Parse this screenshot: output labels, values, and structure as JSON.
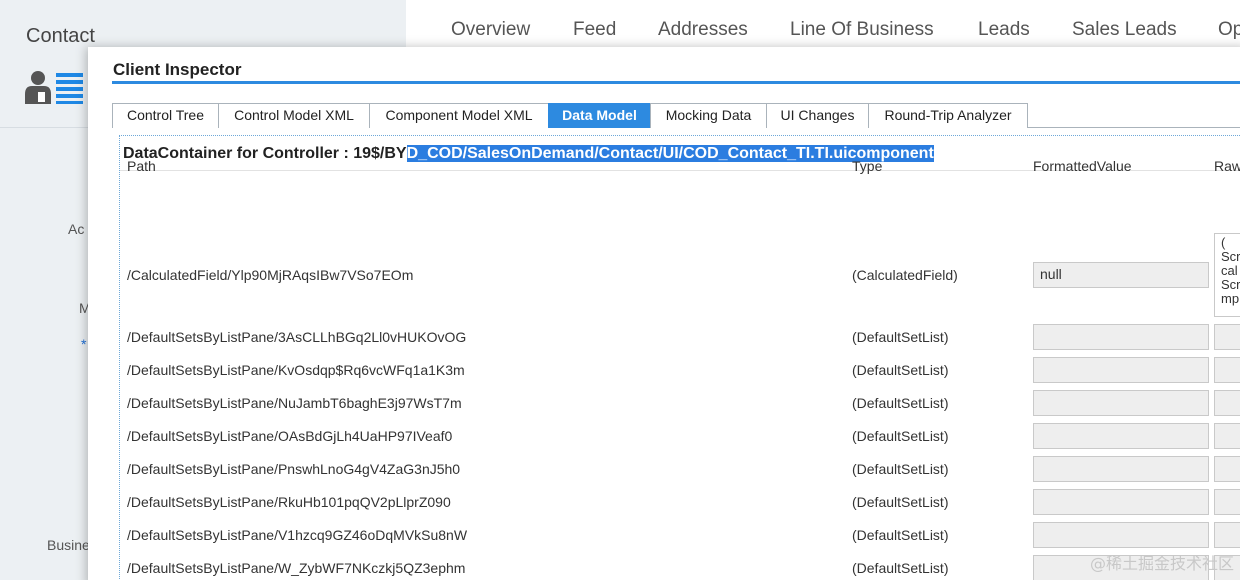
{
  "background": {
    "title": "Contact",
    "left_labels": [
      "Ac",
      "M",
      "*",
      "Busine"
    ],
    "nav_items": [
      "Overview",
      "Feed",
      "Addresses",
      "Line Of Business",
      "Leads",
      "Sales Leads",
      "Op"
    ]
  },
  "inspector": {
    "title": "Client Inspector",
    "tabs": [
      "Control Tree",
      "Control Model XML",
      "Component Model XML",
      "Data Model",
      "Mocking Data",
      "UI Changes",
      "Round-Trip Analyzer"
    ],
    "active_tab": "Data Model",
    "heading_prefix": "DataContainer for Controller : 19$/BY",
    "heading_highlight": "D_COD/SalesOnDemand/Contact/UI/COD_Contact_TI.TI.uicomponent",
    "columns": {
      "path": "Path",
      "type": "Type",
      "formatted": "FormattedValue",
      "raw": "Raw"
    },
    "rows": [
      {
        "path": "/CalculatedField/Ylp90MjRAqsIBw7VSo7EOm",
        "type": "(CalculatedField)",
        "formatted": "null",
        "raw": "(\nScr\ncal\nScr\nmp"
      },
      {
        "path": "/DefaultSetsByListPane/3AsCLLhBGq2Ll0vHUKOvOG",
        "type": "(DefaultSetList)",
        "formatted": "",
        "raw": ""
      },
      {
        "path": "/DefaultSetsByListPane/KvOsdqp$Rq6vcWFq1a1K3m",
        "type": "(DefaultSetList)",
        "formatted": "",
        "raw": ""
      },
      {
        "path": "/DefaultSetsByListPane/NuJambT6baghE3j97WsT7m",
        "type": "(DefaultSetList)",
        "formatted": "",
        "raw": ""
      },
      {
        "path": "/DefaultSetsByListPane/OAsBdGjLh4UaHP97IVeaf0",
        "type": "(DefaultSetList)",
        "formatted": "",
        "raw": ""
      },
      {
        "path": "/DefaultSetsByListPane/PnswhLnoG4gV4ZaG3nJ5h0",
        "type": "(DefaultSetList)",
        "formatted": "",
        "raw": ""
      },
      {
        "path": "/DefaultSetsByListPane/RkuHb101pqQV2pLlprZ090",
        "type": "(DefaultSetList)",
        "formatted": "",
        "raw": ""
      },
      {
        "path": "/DefaultSetsByListPane/V1hzcq9GZ46oDqMVkSu8nW",
        "type": "(DefaultSetList)",
        "formatted": "",
        "raw": ""
      },
      {
        "path": "/DefaultSetsByListPane/W_ZybWF7NKczkj5QZ3ephm",
        "type": "(DefaultSetList)",
        "formatted": "",
        "raw": ""
      }
    ]
  },
  "watermark": "@稀土掘金技术社区",
  "colors": {
    "accent": "#2d8ae0",
    "highlight": "#2b7de0",
    "panel": "#ecf0f3"
  }
}
